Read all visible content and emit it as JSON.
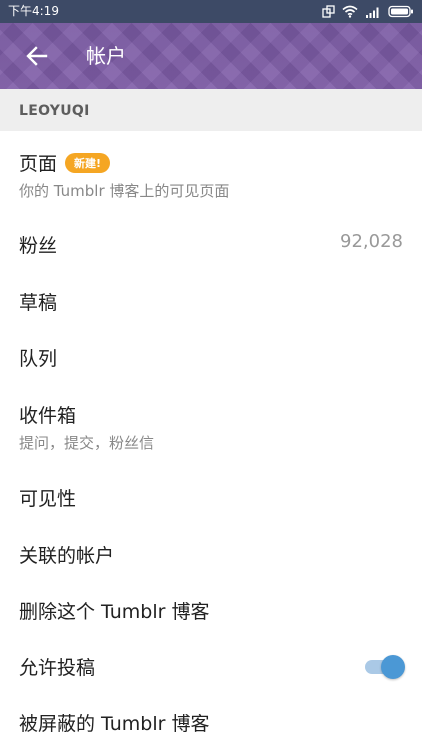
{
  "status_bar": {
    "time": "下午4:19"
  },
  "header": {
    "title": "帐户"
  },
  "section": {
    "name": "LEOYUQI"
  },
  "items": [
    {
      "label": "页面",
      "badge": "新建!",
      "subtitle": "你的 Tumblr 博客上的可见页面"
    },
    {
      "label": "粉丝",
      "value": "92,028"
    },
    {
      "label": "草稿"
    },
    {
      "label": "队列"
    },
    {
      "label": "收件箱",
      "subtitle": "提问，提交，粉丝信"
    },
    {
      "label": "可见性"
    },
    {
      "label": "关联的帐户"
    },
    {
      "label": "删除这个 Tumblr 博客"
    },
    {
      "label": "允许投稿",
      "toggle_on": true
    },
    {
      "label": "被屏蔽的 Tumblr 博客"
    }
  ],
  "colors": {
    "accent": "#4b98d5",
    "badge": "#f5a623",
    "appbar": "#7c5ba6"
  }
}
